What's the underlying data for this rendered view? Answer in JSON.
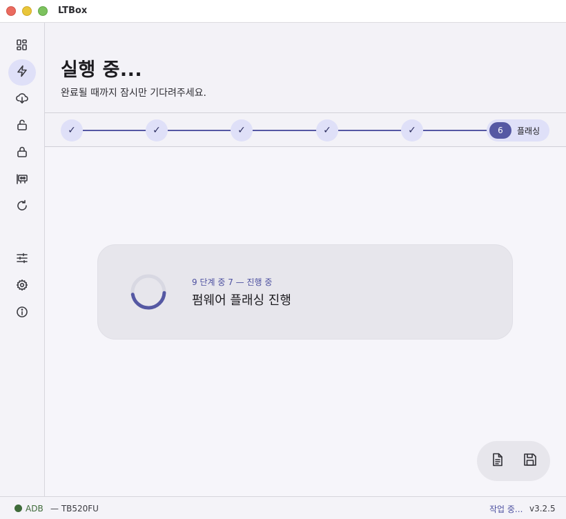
{
  "window": {
    "title": "LTBox"
  },
  "sidebar": {
    "items": [
      {
        "icon": "dashboard-icon"
      },
      {
        "icon": "lightning-icon",
        "active": true
      },
      {
        "icon": "cloud-download-icon"
      },
      {
        "icon": "unlock-icon"
      },
      {
        "icon": "lock-icon"
      },
      {
        "icon": "chip-icon"
      },
      {
        "icon": "refresh-icon"
      },
      {
        "icon": "sliders-icon"
      },
      {
        "icon": "gear-icon"
      },
      {
        "icon": "info-icon"
      }
    ]
  },
  "header": {
    "title": "실행  중...",
    "subtitle": "완료될 때까지 잠시만 기다려주세요."
  },
  "stepper": {
    "done_mark": "✓",
    "current_number": "6",
    "current_label": "플래싱"
  },
  "progress_card": {
    "meta": "9 단계 중 7 — 진행 중",
    "title": "펌웨어 플래싱 진행",
    "step": 7,
    "total_steps": 9
  },
  "actions": {
    "log_icon": "document-icon",
    "save_icon": "save-icon"
  },
  "status": {
    "connection": "ADB",
    "device": "— TB520FU",
    "activity": "작업 중...",
    "version": "v3.2.5"
  },
  "colors": {
    "accent": "#5558a3",
    "accent_soft": "#dfe0f8",
    "status_ok": "#3f6b3a"
  }
}
